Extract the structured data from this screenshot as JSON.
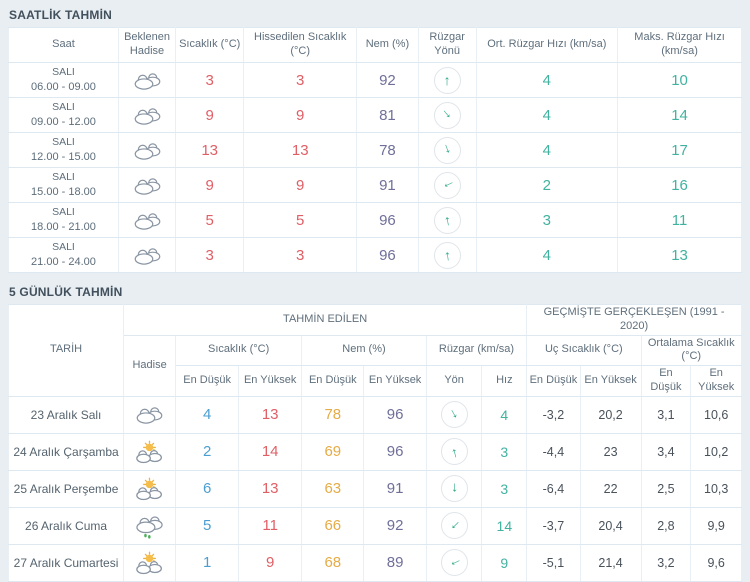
{
  "hourly": {
    "title": "SAATLİK TAHMİN",
    "headers": {
      "saat": "Saat",
      "hadise": "Beklenen Hadise",
      "sicaklik": "Sıcaklık (°C)",
      "hissedilen": "Hissedilen Sıcaklık (°C)",
      "nem": "Nem (%)",
      "ruzgar_yonu": "Rüzgar Yönü",
      "ort_ruzgar": "Ort. Rüzgar Hızı (km/sa)",
      "maks_ruzgar": "Maks. Rüzgar Hızı (km/sa)"
    },
    "rows": [
      {
        "day": "SALI",
        "time": "06.00 - 09.00",
        "icon": "cloudy",
        "temp": "3",
        "feels": "3",
        "humidity": "92",
        "wind_deg": 0,
        "wind_avg": "4",
        "wind_max": "10"
      },
      {
        "day": "SALI",
        "time": "09.00 - 12.00",
        "icon": "cloudy",
        "temp": "9",
        "feels": "9",
        "humidity": "81",
        "wind_deg": 140,
        "wind_avg": "4",
        "wind_max": "14"
      },
      {
        "day": "SALI",
        "time": "12.00 - 15.00",
        "icon": "cloudy",
        "temp": "13",
        "feels": "13",
        "humidity": "78",
        "wind_deg": 160,
        "wind_avg": "4",
        "wind_max": "17"
      },
      {
        "day": "SALI",
        "time": "15.00 - 18.00",
        "icon": "cloudy",
        "temp": "9",
        "feels": "9",
        "humidity": "91",
        "wind_deg": 245,
        "wind_avg": "2",
        "wind_max": "16"
      },
      {
        "day": "SALI",
        "time": "18.00 - 21.00",
        "icon": "cloudy",
        "temp": "5",
        "feels": "5",
        "humidity": "96",
        "wind_deg": -10,
        "wind_avg": "3",
        "wind_max": "11"
      },
      {
        "day": "SALI",
        "time": "21.00 - 24.00",
        "icon": "cloudy",
        "temp": "3",
        "feels": "3",
        "humidity": "96",
        "wind_deg": -8,
        "wind_avg": "4",
        "wind_max": "13"
      }
    ]
  },
  "daily": {
    "title": "5 GÜNLÜK TAHMİN",
    "headers": {
      "tarih": "TARİH",
      "hadise": "Hadise",
      "group_predicted": "TAHMİN EDİLEN",
      "group_historical": "GEÇMİŞTE GERÇEKLEŞEN (1991 - 2020)",
      "sicaklik": "Sıcaklık (°C)",
      "nem": "Nem (%)",
      "ruzgar": "Rüzgar (km/sa)",
      "uc_sicaklik": "Uç Sıcaklık (°C)",
      "ortalama_sicaklik": "Ortalama Sıcaklık (°C)",
      "en_dusuk": "En Düşük",
      "en_yuksek": "En Yüksek",
      "yon": "Yön",
      "hiz": "Hız"
    },
    "rows": [
      {
        "date": "23 Aralık Salı",
        "icon": "cloudy",
        "t_min": "4",
        "t_max": "13",
        "h_min": "78",
        "h_max": "96",
        "wind_deg": 150,
        "speed": "4",
        "u_min": "-3,2",
        "u_max": "20,2",
        "o_min": "3,1",
        "o_max": "10,6"
      },
      {
        "date": "24 Aralık Çarşamba",
        "icon": "partly-sunny",
        "t_min": "2",
        "t_max": "14",
        "h_min": "69",
        "h_max": "96",
        "wind_deg": -15,
        "speed": "3",
        "u_min": "-4,4",
        "u_max": "23",
        "o_min": "3,4",
        "o_max": "10,2"
      },
      {
        "date": "25 Aralık Perşembe",
        "icon": "partly-sunny",
        "t_min": "6",
        "t_max": "13",
        "h_min": "63",
        "h_max": "91",
        "wind_deg": 180,
        "speed": "3",
        "u_min": "-6,4",
        "u_max": "22",
        "o_min": "2,5",
        "o_max": "10,3"
      },
      {
        "date": "26 Aralık Cuma",
        "icon": "rainy",
        "t_min": "5",
        "t_max": "11",
        "h_min": "66",
        "h_max": "92",
        "wind_deg": 225,
        "speed": "14",
        "u_min": "-3,7",
        "u_max": "20,4",
        "o_min": "2,8",
        "o_max": "9,9"
      },
      {
        "date": "27 Aralık Cumartesi",
        "icon": "partly-sunny",
        "t_min": "1",
        "t_max": "9",
        "h_min": "68",
        "h_max": "89",
        "wind_deg": 245,
        "speed": "9",
        "u_min": "-5,1",
        "u_max": "21,4",
        "o_min": "3,2",
        "o_max": "9,6"
      }
    ]
  },
  "colors": {
    "temp_max_red": "#e05f66",
    "temp_min_blue": "#4b9fd0",
    "humidity_min_orange": "#e5ab45",
    "humidity_max_purple": "#6f6f9a",
    "wind_teal": "#41b2a0",
    "arrow_green": "#2faa86",
    "historic_dark": "#49525b",
    "background": "#e8eef2"
  }
}
